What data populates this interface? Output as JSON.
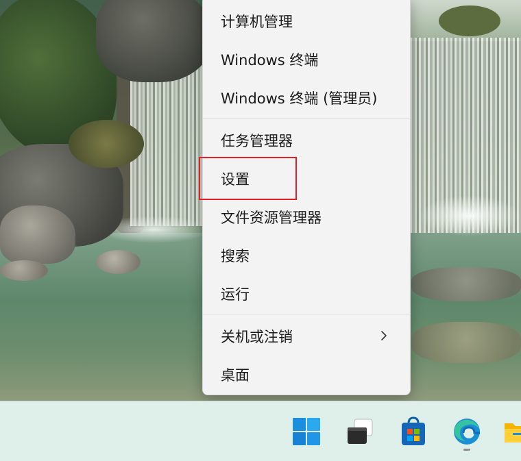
{
  "menu": {
    "items": [
      {
        "id": "computer-management",
        "label": "计算机管理"
      },
      {
        "id": "terminal",
        "label": "Windows 终端"
      },
      {
        "id": "terminal-admin",
        "label": "Windows 终端 (管理员)"
      },
      {
        "id": "task-manager",
        "label": "任务管理器"
      },
      {
        "id": "settings",
        "label": "设置",
        "highlighted": true
      },
      {
        "id": "file-explorer",
        "label": "文件资源管理器"
      },
      {
        "id": "search",
        "label": "搜索"
      },
      {
        "id": "run",
        "label": "运行"
      },
      {
        "id": "shutdown",
        "label": "关机或注销",
        "has_submenu": true,
        "submenu_icon": "chevron-right-icon"
      },
      {
        "id": "desktop",
        "label": "桌面"
      }
    ]
  },
  "taskbar": {
    "icons": [
      "windows-start-icon",
      "task-view-icon",
      "microsoft-store-icon",
      "edge-browser-icon",
      "file-explorer-icon"
    ]
  },
  "colors": {
    "highlight_box": "#e0212a",
    "menu_background": "#f3f3f3",
    "taskbar_background": "#dfefe9",
    "windows_blue": "#1a8fe0"
  }
}
